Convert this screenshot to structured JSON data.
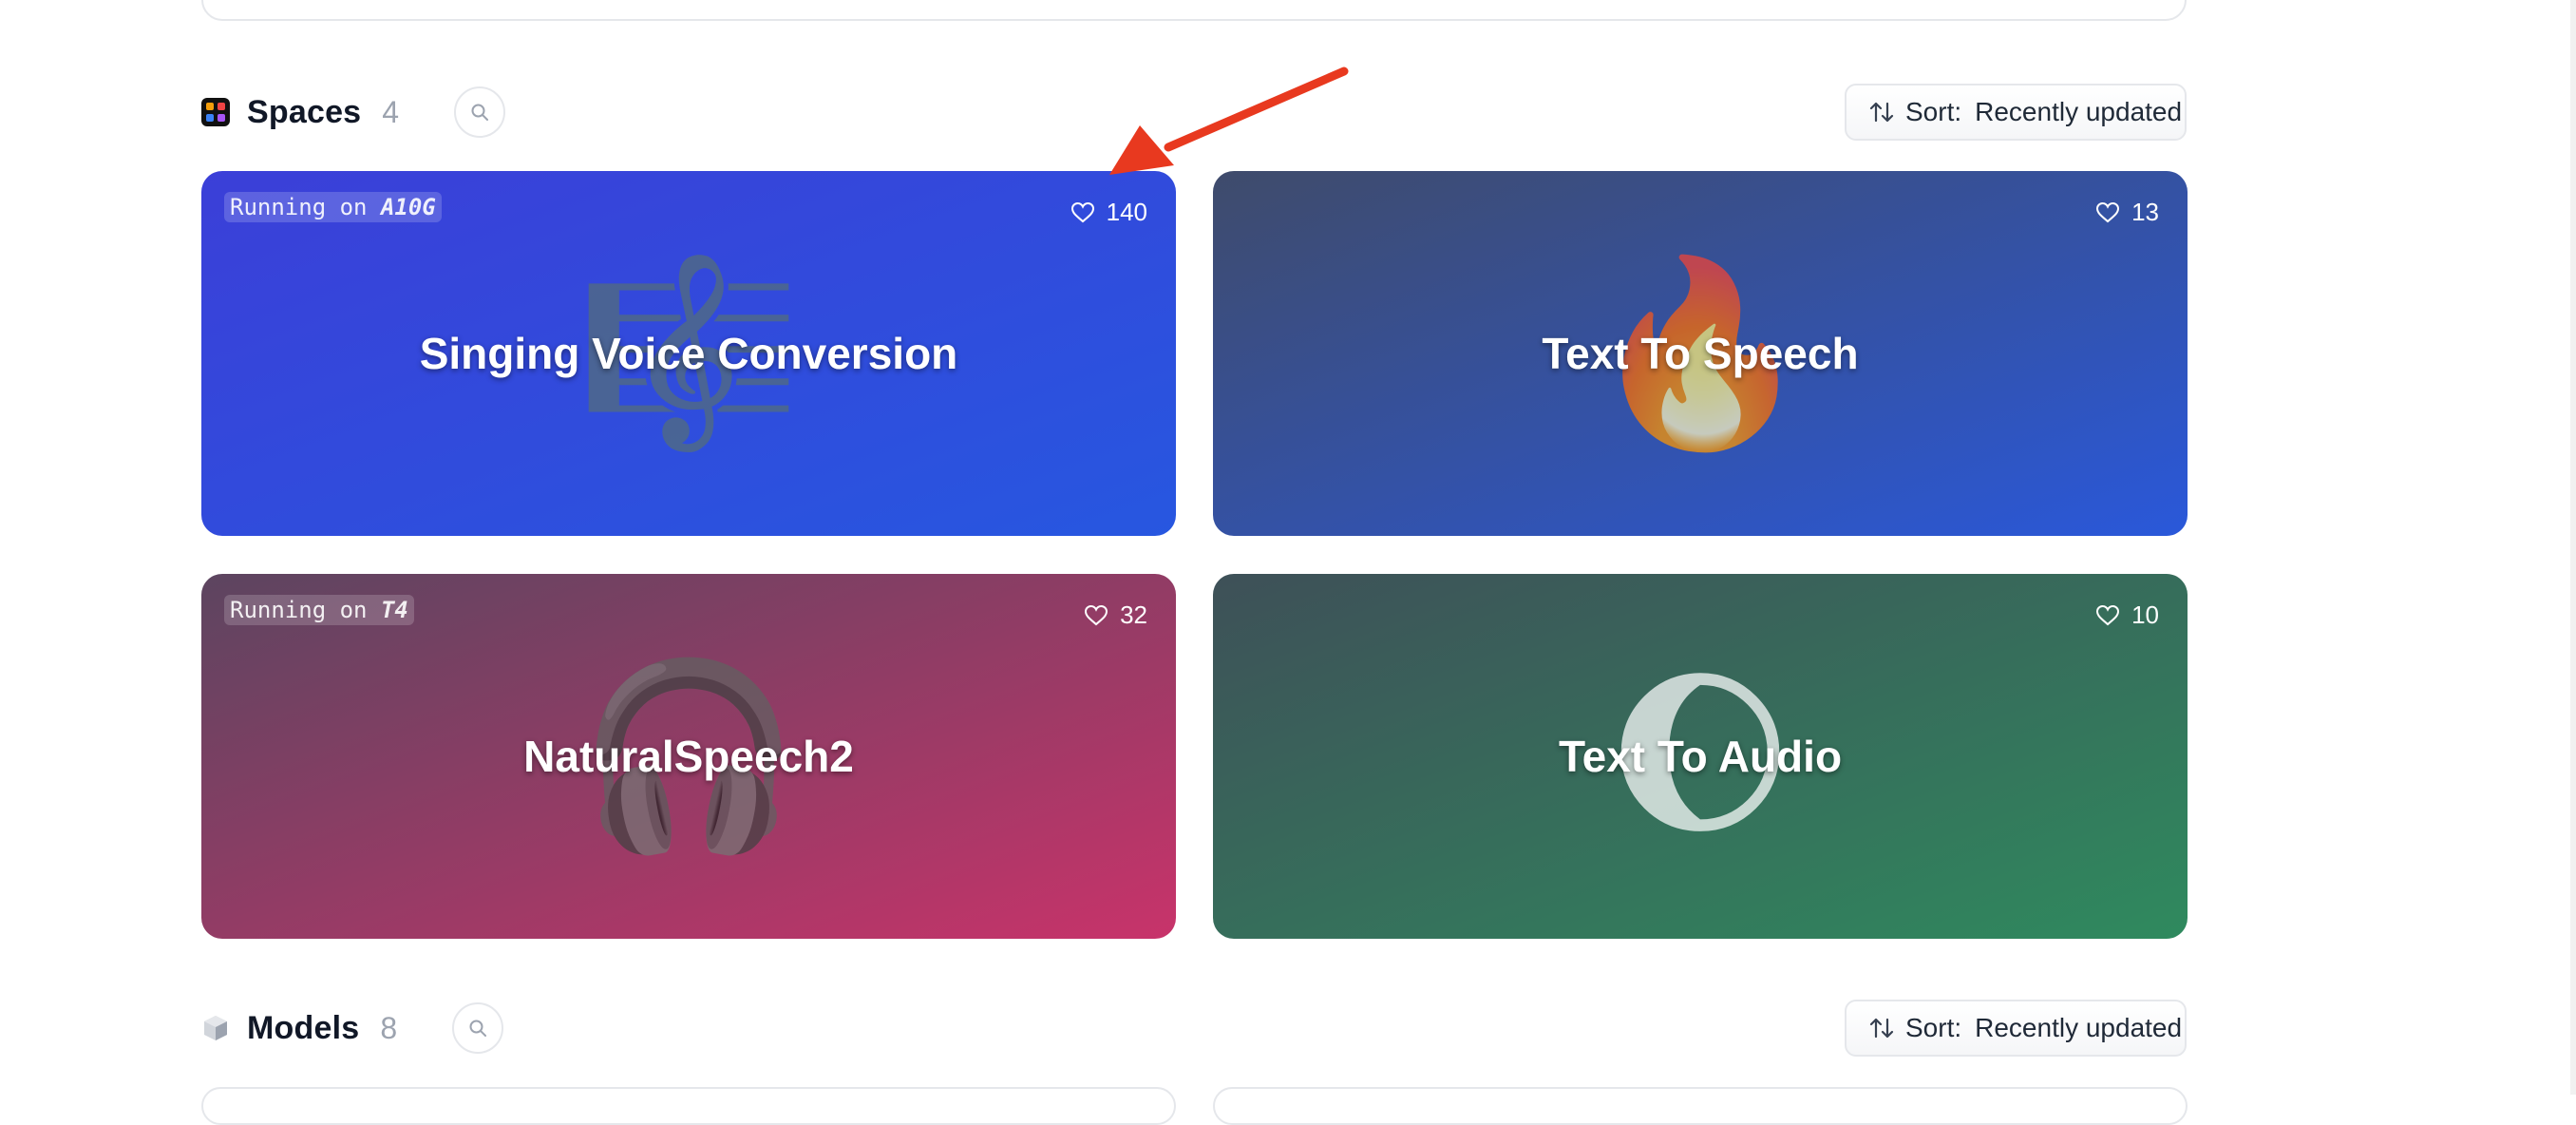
{
  "spaces": {
    "title": "Spaces",
    "count": "4",
    "sort_label": "Sort:",
    "sort_value": "Recently updated",
    "cards": [
      {
        "running_prefix": "Running on",
        "hardware": "A10G",
        "likes": "140",
        "title": "Singing Voice Conversion",
        "emoji": "🎼",
        "gradient": [
          "#3b3fd8",
          "#2757e0"
        ]
      },
      {
        "running_prefix": "",
        "hardware": "",
        "likes": "13",
        "title": "Text To Speech",
        "emoji": "🔥",
        "gradient": [
          "#3f4b6b",
          "#2a58da"
        ]
      },
      {
        "running_prefix": "Running on",
        "hardware": "T4",
        "likes": "32",
        "title": "NaturalSpeech2",
        "emoji": "🎧",
        "gradient": [
          "#5c4560",
          "#c8336a"
        ]
      },
      {
        "running_prefix": "",
        "hardware": "",
        "likes": "10",
        "title": "Text To Audio",
        "emoji": "🌔",
        "gradient": [
          "#3e5058",
          "#2f8a5e"
        ]
      }
    ]
  },
  "models": {
    "title": "Models",
    "count": "8",
    "sort_label": "Sort:",
    "sort_value": "Recently updated"
  },
  "annotation": {
    "arrow_color": "#e8391f"
  }
}
